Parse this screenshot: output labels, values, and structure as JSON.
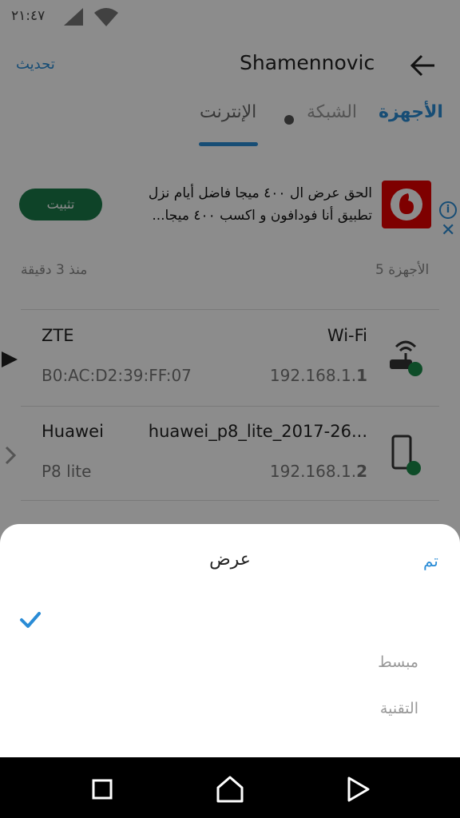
{
  "status_bar": {
    "time": "٢١:٤٧",
    "signal_icon": "signal-icon",
    "wifi_icon": "wifi-icon"
  },
  "app_bar": {
    "title": "Shamennovic",
    "refresh_label": "تحديث",
    "back_icon": "back-arrow-icon"
  },
  "tabs": [
    {
      "label": "الأجهزة",
      "active": true
    },
    {
      "label": "الشبكة",
      "active": false
    },
    {
      "label": "الإنترنت",
      "active": false
    }
  ],
  "ad": {
    "text": "الحق عرض ال ٤٠٠ ميجا فاضل أيام نزل تطبيق أنا فودافون و اكسب ٤٠٠ ميجا...",
    "install_label": "تثبيت",
    "logo": "vodafone-logo",
    "brand_color": "#e60000"
  },
  "list": {
    "devices_count": "5 الأجهزة",
    "updated": "منذ 3 دقيقة",
    "devices": [
      {
        "name": "ZTE",
        "sub": "B0:AC:D2:39:FF:07",
        "connection": "Wi-Fi",
        "ip_prefix": "192.168.1.",
        "ip_last": "1",
        "icon": "router-icon",
        "status_color": "#1a8a4a"
      },
      {
        "name": "Huawei",
        "sub": "P8 lite",
        "connection": "huawei_p8_lite_2017-26...",
        "ip_prefix": "192.168.1.",
        "ip_last": "2",
        "icon": "phone-icon",
        "status_color": "#1a8a4a"
      }
    ]
  },
  "sheet": {
    "title": "عرض",
    "done_label": "تم",
    "options": [
      "مبسط",
      "التقنية"
    ]
  },
  "colors": {
    "accent": "#2a8cd6",
    "install_green": "#1a7a4a"
  }
}
